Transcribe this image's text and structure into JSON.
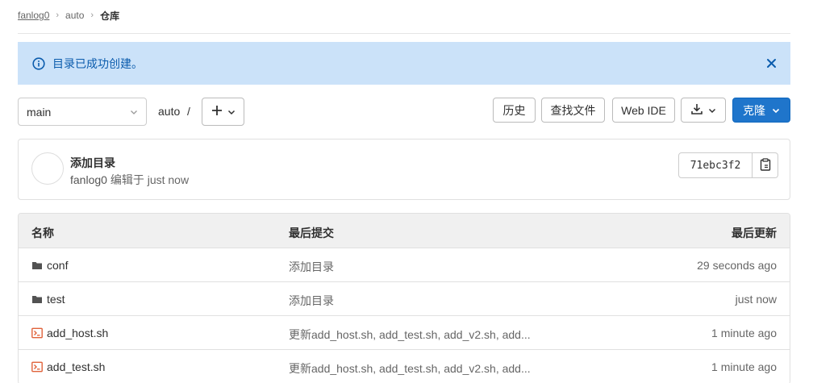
{
  "breadcrumb": {
    "owner": "fanlog0",
    "project": "auto",
    "current": "仓库"
  },
  "alert": {
    "message": "目录已成功创建。",
    "icon": "info-circle-icon",
    "close_icon": "close-icon",
    "color": "#0b5cad",
    "background": "#cbe2f9"
  },
  "toolbar": {
    "branch": "main",
    "path": "auto",
    "path_separator": "/",
    "history_label": "历史",
    "find_file_label": "查找文件",
    "web_ide_label": "Web IDE",
    "clone_label": "克隆",
    "clone_color": "#1f75cb"
  },
  "commit": {
    "title": "添加目录",
    "author": "fanlog0",
    "action": "编辑于",
    "time": "just now",
    "sha": "71ebc3f2"
  },
  "table": {
    "headers": {
      "name": "名称",
      "last_commit": "最后提交",
      "last_update": "最后更新"
    },
    "rows": [
      {
        "type": "folder",
        "name": "conf",
        "commit": "添加目录",
        "updated": "29 seconds ago"
      },
      {
        "type": "folder",
        "name": "test",
        "commit": "添加目录",
        "updated": "just now"
      },
      {
        "type": "shell",
        "name": "add_host.sh",
        "commit": "更新add_host.sh, add_test.sh, add_v2.sh, add...",
        "updated": "1 minute ago"
      },
      {
        "type": "shell",
        "name": "add_test.sh",
        "commit": "更新add_host.sh, add_test.sh, add_v2.sh, add...",
        "updated": "1 minute ago"
      }
    ]
  }
}
